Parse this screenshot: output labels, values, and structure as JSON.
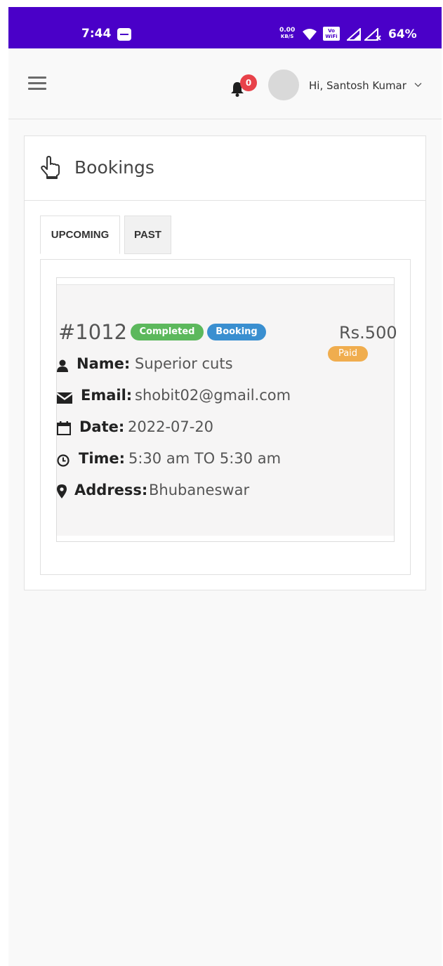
{
  "status_bar": {
    "time": "7:44",
    "net_speed_value": "0.00",
    "net_speed_unit": "KB/S",
    "vowifi": "Vo\nWiFi 1",
    "battery": "64%"
  },
  "header": {
    "notification_count": "0",
    "greeting": "Hi, Santosh Kumar"
  },
  "card": {
    "title": "Bookings"
  },
  "tabs": [
    {
      "label": "UPCOMING",
      "active": true
    },
    {
      "label": "PAST",
      "active": false
    }
  ],
  "booking": {
    "id": "#1012",
    "badges": [
      "Completed",
      "Booking"
    ],
    "price": "Rs.500",
    "payment_status": "Paid",
    "details": {
      "name_label": "Name",
      "name_value": "Superior cuts",
      "email_label": "Email",
      "email_value": "shobit02@gmail.com",
      "date_label": "Date",
      "date_value": "2022-07-20",
      "time_label": "Time",
      "time_value": "5:30 am TO 5:30 am",
      "address_label": "Address",
      "address_value": "Bhubaneswar"
    },
    "colon": ":"
  },
  "colors": {
    "status_bar": "#4a00c8",
    "badge_completed": "#5cb85c",
    "badge_booking": "#3a8fd0",
    "badge_paid": "#f0ad4e",
    "notification_badge": "#e8424a"
  },
  "icons": {
    "menu": "hamburger-icon",
    "bell": "bell-icon",
    "caret": "chevron-down-icon",
    "bookings": "hand-pointer-icon",
    "name": "user-icon",
    "email": "envelope-icon",
    "date": "calendar-icon",
    "time": "clock-icon",
    "address": "map-marker-icon"
  }
}
